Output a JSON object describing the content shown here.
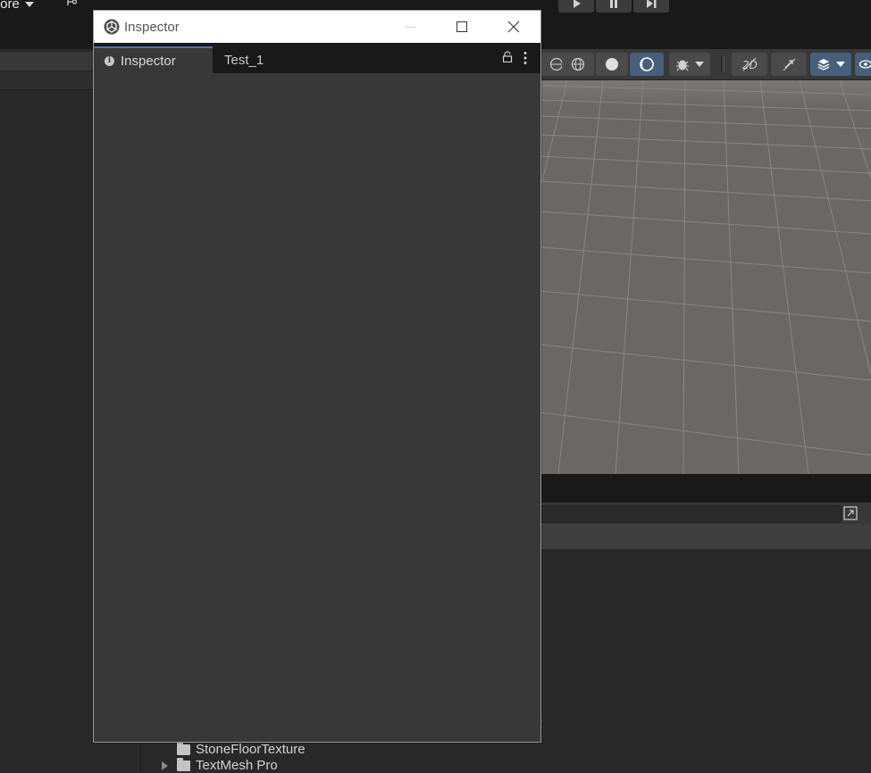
{
  "background": {
    "toolbar": {
      "store_label": "tore"
    },
    "project_tree": {
      "items": [
        {
          "label": "StoneFloorTexture"
        },
        {
          "label": "TextMesh Pro"
        }
      ]
    },
    "peek_text": "s"
  },
  "window": {
    "title": "Inspector",
    "tabs": [
      {
        "label": "Inspector"
      },
      {
        "label": "Test_1"
      }
    ]
  },
  "colors": {
    "accent": "#3a79bb",
    "panel": "#383838",
    "header": "#191919",
    "scene": "#6c6664"
  },
  "icons": [
    "branch-icon",
    "play-icon",
    "pause-icon",
    "step-icon",
    "lock-icon",
    "more-icon",
    "info-icon",
    "folder-icon",
    "unity-icon",
    "minimize-icon",
    "maximize-icon",
    "close-icon",
    "expand-icon"
  ]
}
